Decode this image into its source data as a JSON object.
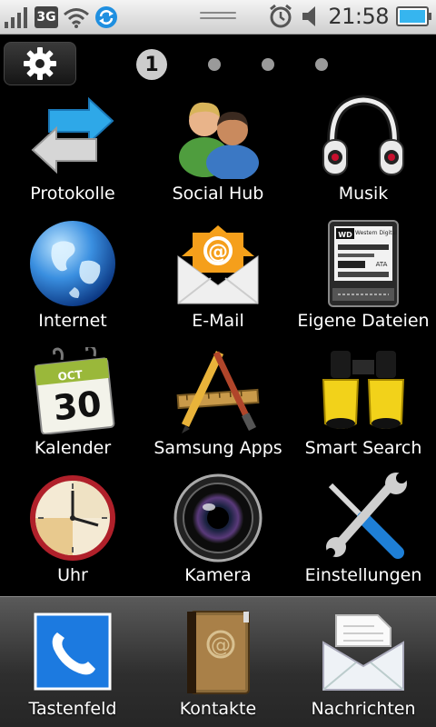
{
  "status_bar": {
    "network_type": "3G",
    "time": "21:58",
    "icons": [
      "signal-icon",
      "wifi-icon",
      "sync-icon",
      "alarm-icon",
      "volume-icon",
      "battery-icon"
    ]
  },
  "home": {
    "current_page": "1",
    "page_count": 4,
    "settings_icon": "gear-icon"
  },
  "apps": [
    {
      "label": "Protokolle",
      "icon": "arrows-icon"
    },
    {
      "label": "Social Hub",
      "icon": "people-icon"
    },
    {
      "label": "Musik",
      "icon": "headphones-icon"
    },
    {
      "label": "Internet",
      "icon": "globe-icon"
    },
    {
      "label": "E-Mail",
      "icon": "envelope-icon"
    },
    {
      "label": "Eigene Dateien",
      "icon": "hard-drive-icon"
    },
    {
      "label": "Kalender",
      "icon": "calendar-icon",
      "badge_month": "OCT",
      "badge_day": "30"
    },
    {
      "label": "Samsung Apps",
      "icon": "app-store-icon"
    },
    {
      "label": "Smart Search",
      "icon": "binoculars-icon"
    },
    {
      "label": "Uhr",
      "icon": "clock-icon"
    },
    {
      "label": "Kamera",
      "icon": "camera-lens-icon"
    },
    {
      "label": "Einstellungen",
      "icon": "tools-icon"
    }
  ],
  "dock": [
    {
      "label": "Tastenfeld",
      "icon": "phone-icon"
    },
    {
      "label": "Kontakte",
      "icon": "address-book-icon"
    },
    {
      "label": "Nachrichten",
      "icon": "message-icon"
    }
  ],
  "drive_label": {
    "brand": "Western Digital",
    "model": "ATA"
  }
}
